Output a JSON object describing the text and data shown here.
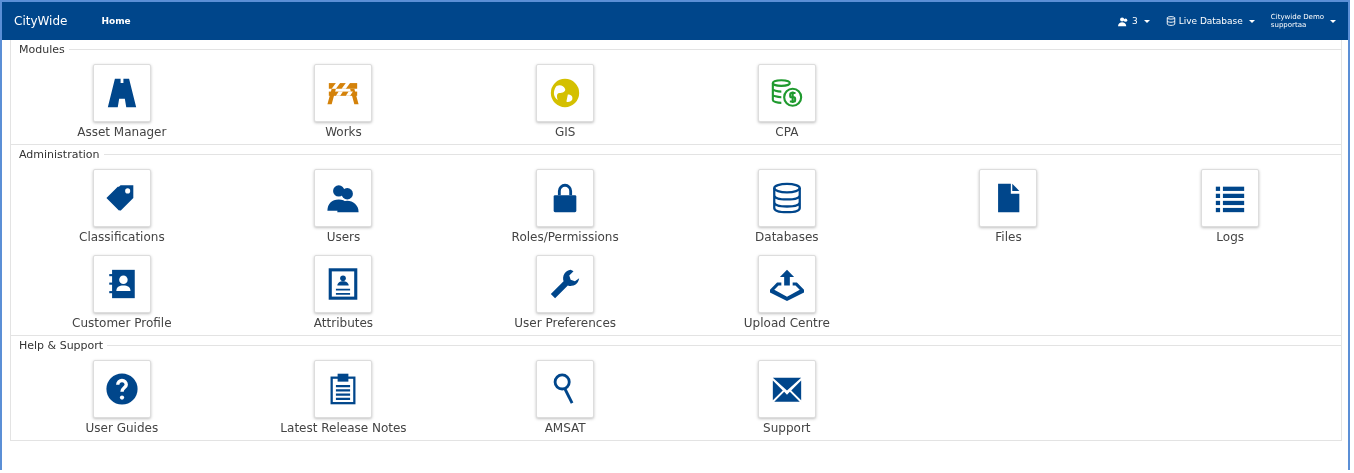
{
  "navbar": {
    "brand": "CityWide",
    "links": [
      {
        "label": "Home"
      }
    ],
    "notifications": {
      "count": "3"
    },
    "database": {
      "label": "Live Database"
    },
    "user": {
      "name": "Citywide Demo",
      "login": "supportaa"
    }
  },
  "sections": [
    {
      "title": "Modules",
      "tiles": [
        {
          "label": "Asset Manager",
          "kind": "road",
          "color": "#00468b"
        },
        {
          "label": "Works",
          "kind": "barrier",
          "color": "#d4820a"
        },
        {
          "label": "GIS",
          "kind": "globe",
          "color": "#d4c000"
        },
        {
          "label": "CPA",
          "kind": "coins",
          "color": "#1f9a2e"
        }
      ]
    },
    {
      "title": "Administration",
      "tiles": [
        {
          "label": "Classifications",
          "kind": "tags",
          "color": "#00468b"
        },
        {
          "label": "Users",
          "kind": "users",
          "color": "#00468b"
        },
        {
          "label": "Roles/Permissions",
          "kind": "lock",
          "color": "#00468b"
        },
        {
          "label": "Databases",
          "kind": "database",
          "color": "#00468b"
        },
        {
          "label": "Files",
          "kind": "file",
          "color": "#00468b"
        },
        {
          "label": "Logs",
          "kind": "list",
          "color": "#00468b"
        },
        {
          "label": "Customer Profile",
          "kind": "contact-book",
          "color": "#00468b"
        },
        {
          "label": "Attributes",
          "kind": "id-card",
          "color": "#00468b"
        },
        {
          "label": "User Preferences",
          "kind": "wrench",
          "color": "#00468b"
        },
        {
          "label": "Upload Centre",
          "kind": "upload",
          "color": "#00468b"
        }
      ]
    },
    {
      "title": "Help & Support",
      "tiles": [
        {
          "label": "User Guides",
          "kind": "question",
          "color": "#00468b"
        },
        {
          "label": "Latest Release Notes",
          "kind": "clipboard",
          "color": "#00468b"
        },
        {
          "label": "AMSAT",
          "kind": "magnifier",
          "color": "#00468b"
        },
        {
          "label": "Support",
          "kind": "envelope",
          "color": "#00468b"
        }
      ]
    }
  ]
}
